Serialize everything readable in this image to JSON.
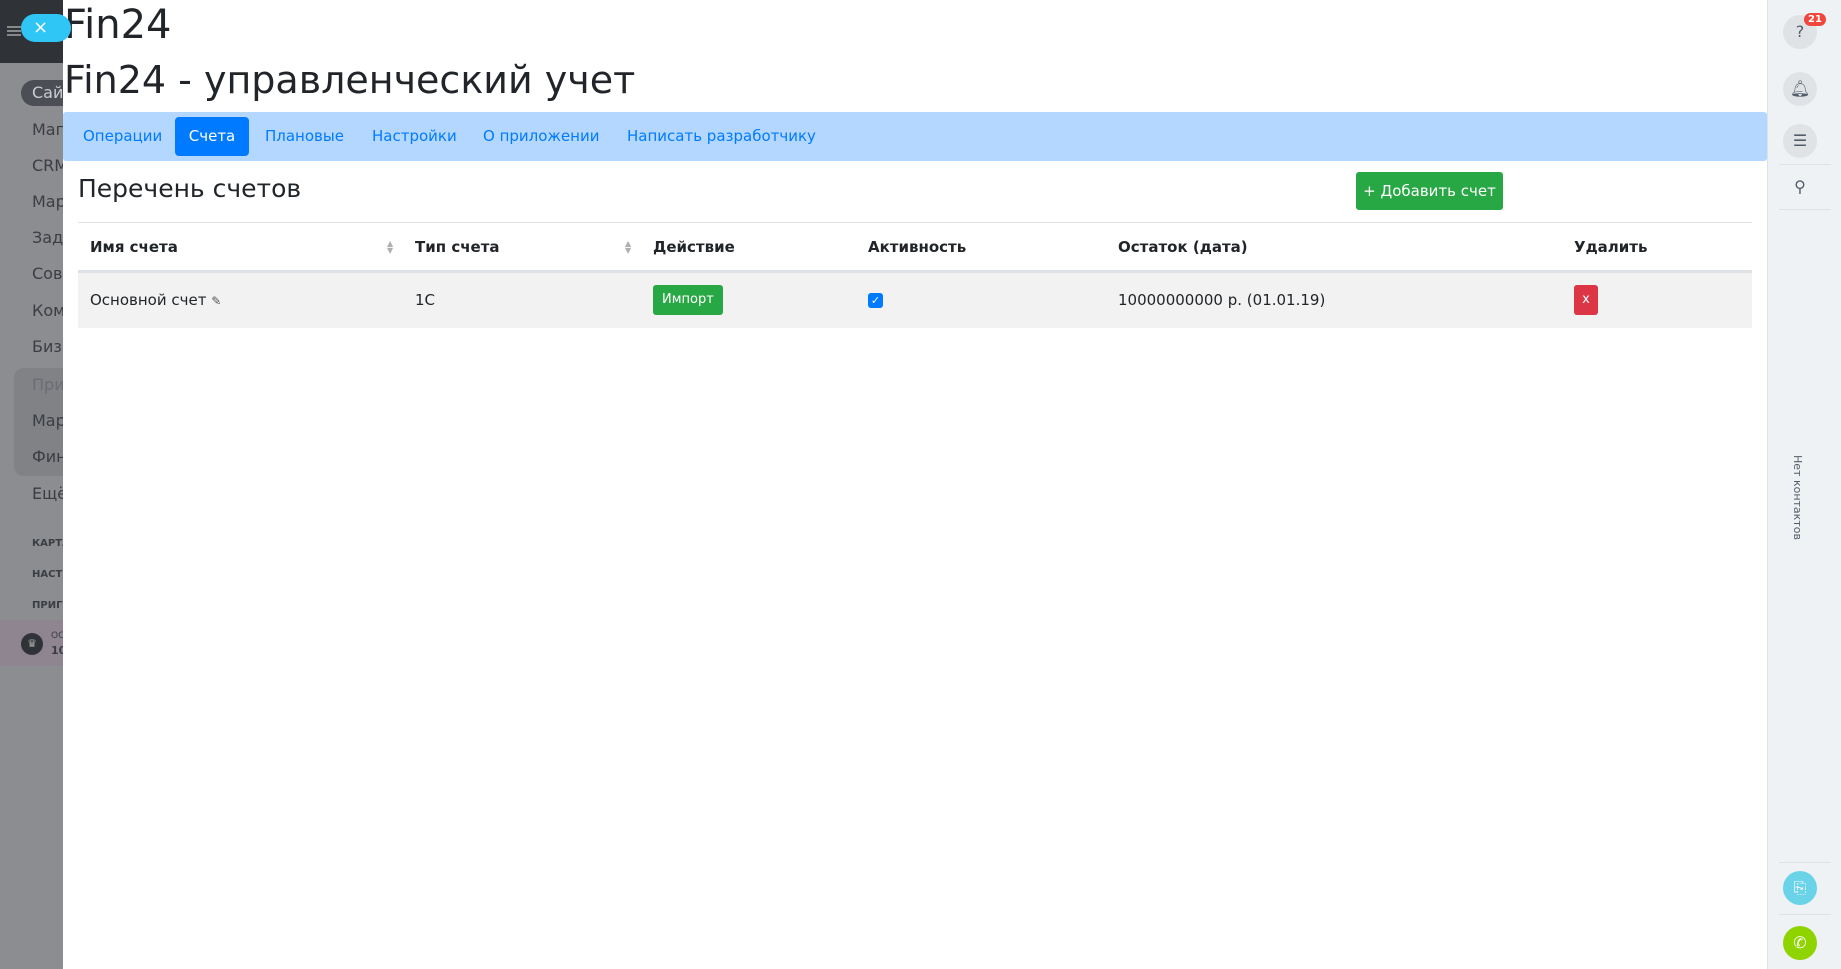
{
  "sidebar": {
    "pill": "Сайт",
    "items": [
      "Мага",
      "CRM",
      "Мар",
      "Зада",
      "Совм",
      "Ком",
      "Бизн",
      "При",
      "Мар",
      "Фин",
      "Ещё"
    ],
    "small": [
      "КАРТА",
      "НАСТР",
      "ПРИГЛ"
    ],
    "crown_top": "ОС",
    "crown_bottom": "10"
  },
  "close_icon": "×",
  "app_title": "Fin24",
  "page_title": "Fin24 - управленческий учет",
  "tabs": [
    "Операции",
    "Счета",
    "Плановые",
    "Настройки",
    "О приложении",
    "Написать разработчику"
  ],
  "active_tab": "Счета",
  "heading": "Перечень счетов",
  "add_button": "+ Добавить счет",
  "table": {
    "headers": [
      "Имя счета",
      "Тип счета",
      "Действие",
      "Активность",
      "Остаток (дата)",
      "Удалить"
    ],
    "rows": [
      {
        "name": "Основной счет",
        "type": "1С",
        "action": "Импорт",
        "active": true,
        "balance": "10000000000 р. (01.01.19)",
        "delete": "x"
      }
    ]
  },
  "rightbar": {
    "badge": "21",
    "no_contacts": "Нет контактов"
  },
  "colors": {
    "primary": "#007bff",
    "success": "#28a745",
    "danger": "#dc3545",
    "nav_bg": "#b3d7ff"
  }
}
